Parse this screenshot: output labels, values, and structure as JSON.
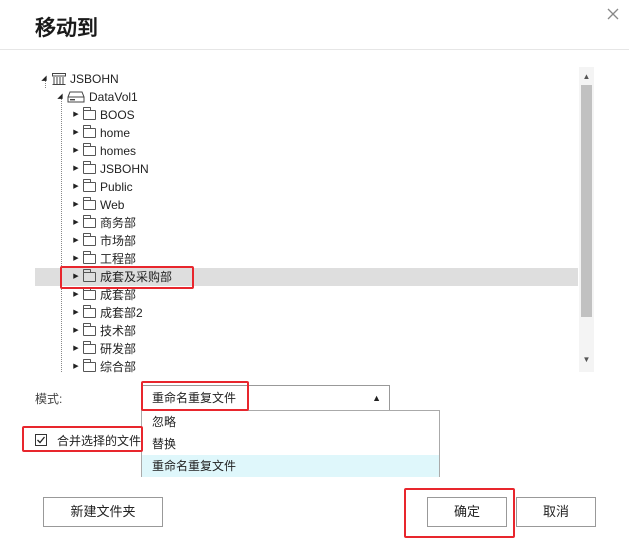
{
  "dialog": {
    "title": "移动到"
  },
  "tree": {
    "root": {
      "label": "JSBOHN",
      "icon": "nas-server-icon"
    },
    "volume": {
      "label": "DataVol1",
      "icon": "drive-icon"
    },
    "folders": [
      {
        "label": "BOOS"
      },
      {
        "label": "home"
      },
      {
        "label": "homes"
      },
      {
        "label": "JSBOHN"
      },
      {
        "label": "Public"
      },
      {
        "label": "Web"
      },
      {
        "label": "商务部"
      },
      {
        "label": "市场部"
      },
      {
        "label": "工程部"
      },
      {
        "label": "成套及采购部",
        "selected": true
      },
      {
        "label": "成套部"
      },
      {
        "label": "成套部2"
      },
      {
        "label": "技术部"
      },
      {
        "label": "研发部"
      },
      {
        "label": "综合部"
      }
    ]
  },
  "mode": {
    "label": "模式:",
    "selected": "重命名重复文件",
    "options": [
      "忽略",
      "替换",
      "重命名重复文件"
    ]
  },
  "merge": {
    "label": "合并选择的文件",
    "checked": true
  },
  "buttons": {
    "new_folder": "新建文件夹",
    "confirm": "确定",
    "cancel": "取消"
  },
  "colors": {
    "highlight": "#e8262d",
    "selected_row": "#dedede",
    "dropdown_active": "#dff7fb"
  }
}
